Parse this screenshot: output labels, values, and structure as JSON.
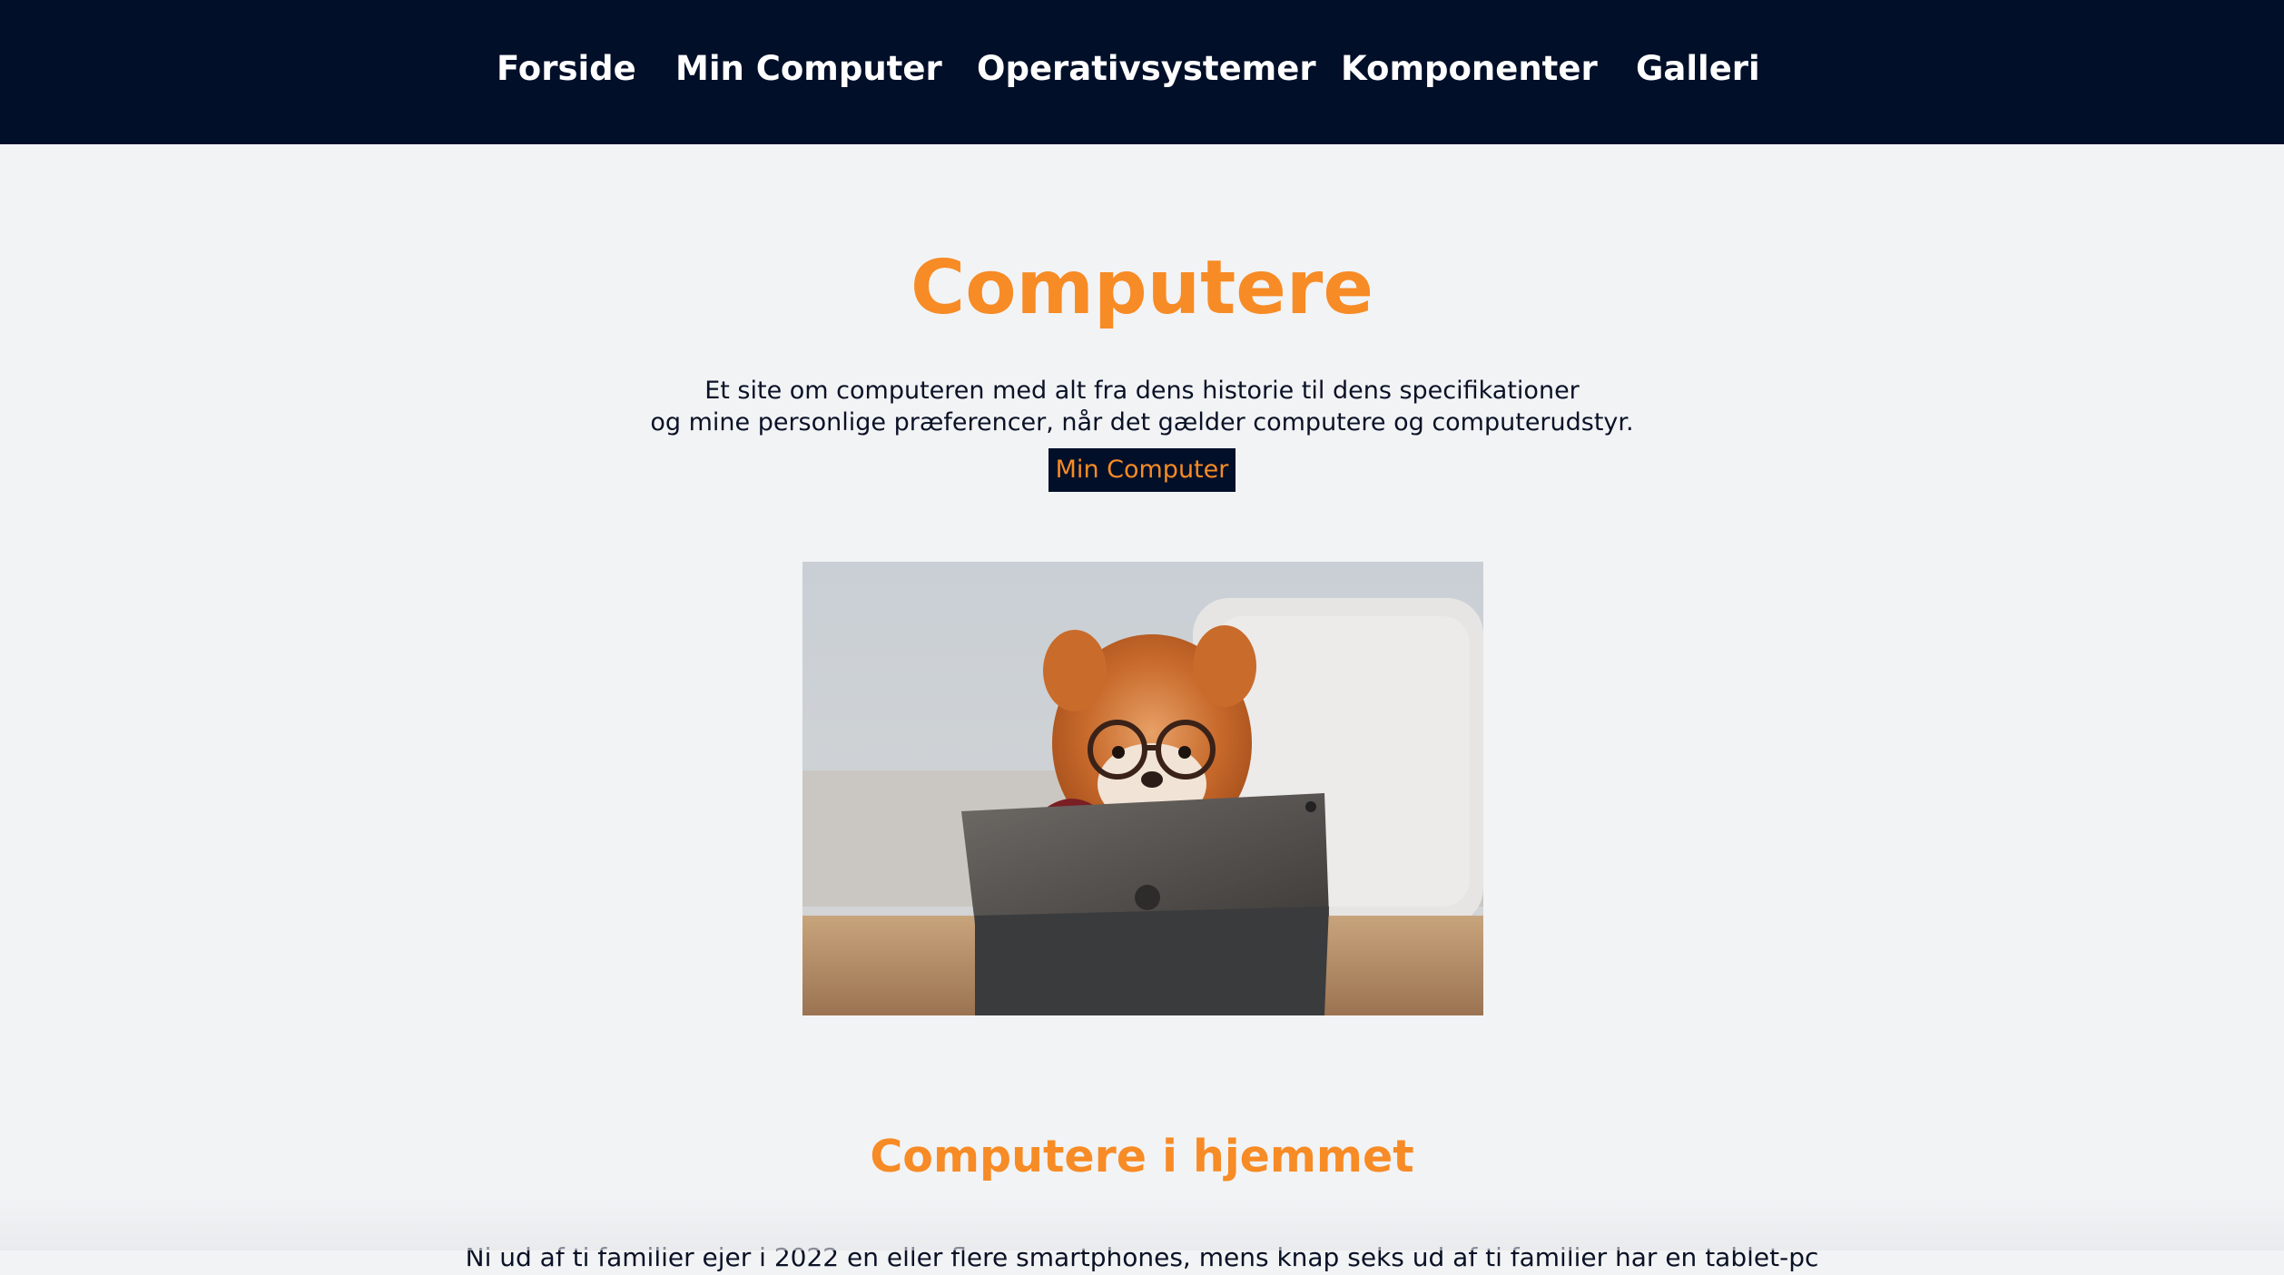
{
  "nav": {
    "items": [
      {
        "label": "Forside"
      },
      {
        "label": "Min Computer"
      },
      {
        "label": "Operativsystemer"
      },
      {
        "label": "Komponenter"
      },
      {
        "label": "Galleri"
      }
    ]
  },
  "hero": {
    "title": "Computere",
    "intro_line1": "Et site om computeren med alt fra dens historie til dens specifikationer",
    "intro_line2": "og mine personlige præferencer, når det gælder computere og computerudstyr.",
    "button_label": "Min Computer"
  },
  "section": {
    "title": "Computere i hjemmet",
    "text": "Ni ud af ti familier ejer i 2022 en eller flere smartphones, mens knap seks ud af ti familier har en tablet-pc"
  },
  "colors": {
    "nav_background": "#010f29",
    "accent": "#f78b25",
    "page_background": "#f2f3f5",
    "text": "#0a1226"
  }
}
